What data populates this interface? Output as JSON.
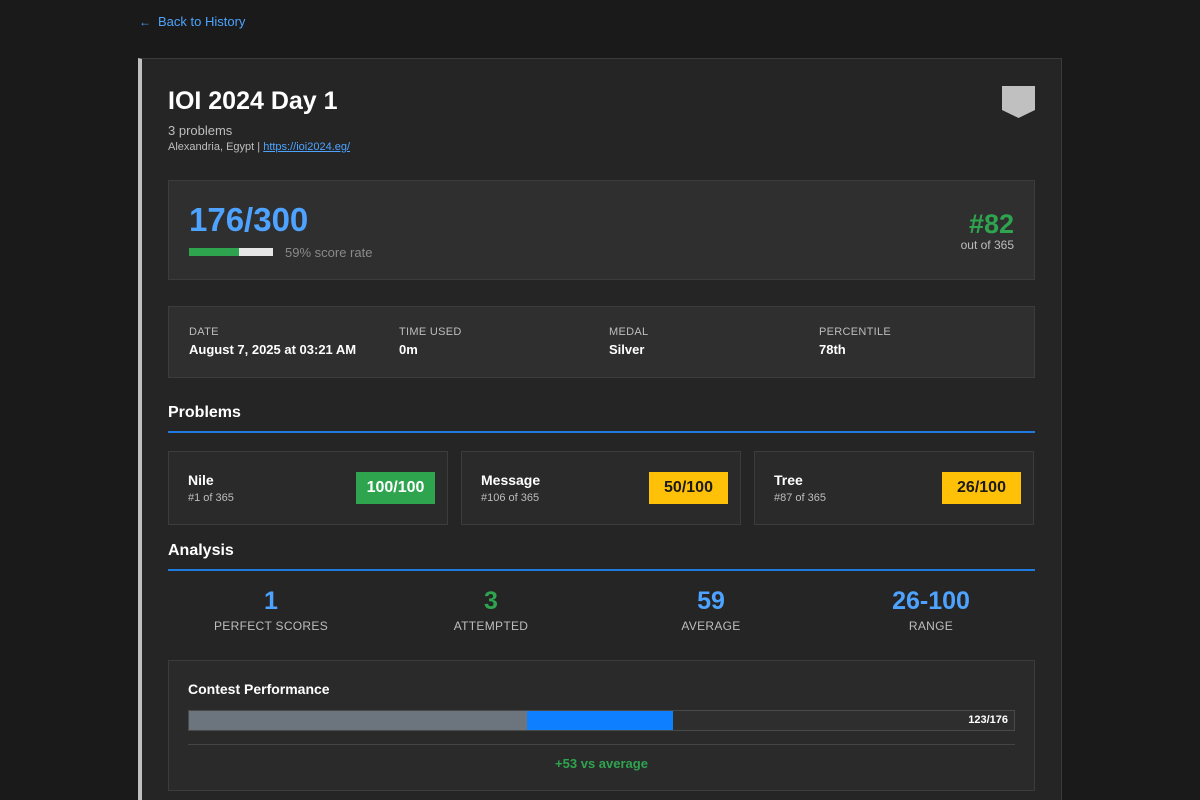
{
  "nav": {
    "back_label": "Back to History",
    "back_icon": "arrow-left-icon"
  },
  "contest": {
    "title": "IOI 2024 Day 1",
    "problems_count": "3 problems",
    "location": "Alexandria, Egypt",
    "separator": "|",
    "url": "https://ioi2024.eg/",
    "medal_icon": "silver-medal-badge-icon",
    "medal_color": "#c0c0c0"
  },
  "score": {
    "display": "176/300",
    "rate_fraction": 0.59,
    "rate_text": "59% score rate",
    "rank": "#82",
    "rank_sub": "out of 365"
  },
  "info": [
    {
      "label": "DATE",
      "value": "August 7, 2025 at 03:21 AM"
    },
    {
      "label": "TIME USED",
      "value": "0m"
    },
    {
      "label": "MEDAL",
      "value": "Silver"
    },
    {
      "label": "PERCENTILE",
      "value": "78th"
    }
  ],
  "problems_section": {
    "title": "Problems"
  },
  "problems": [
    {
      "name": "Nile",
      "rank": "#1 of 365",
      "score": "100/100",
      "status": "full"
    },
    {
      "name": "Message",
      "rank": "#106 of 365",
      "score": "50/100",
      "status": "partial"
    },
    {
      "name": "Tree",
      "rank": "#87 of 365",
      "score": "26/100",
      "status": "partial"
    }
  ],
  "analysis_section": {
    "title": "Analysis"
  },
  "stats": [
    {
      "value": "1",
      "label": "PERFECT SCORES",
      "color": "blue"
    },
    {
      "value": "3",
      "label": "ATTEMPTED",
      "color": "green"
    },
    {
      "value": "59",
      "label": "AVERAGE",
      "color": "blue"
    },
    {
      "value": "26-100",
      "label": "RANGE",
      "color": "blue"
    }
  ],
  "performance": {
    "title": "Contest Performance",
    "average_score": 123,
    "your_score": 176,
    "max_score": 300,
    "bar_label": "123/176",
    "diff_text": "+53 vs average"
  },
  "colors": {
    "accent": "#4da3ff",
    "success": "#2ea44f",
    "warning": "#ffc107",
    "section_rule": "#1f7ae0"
  }
}
